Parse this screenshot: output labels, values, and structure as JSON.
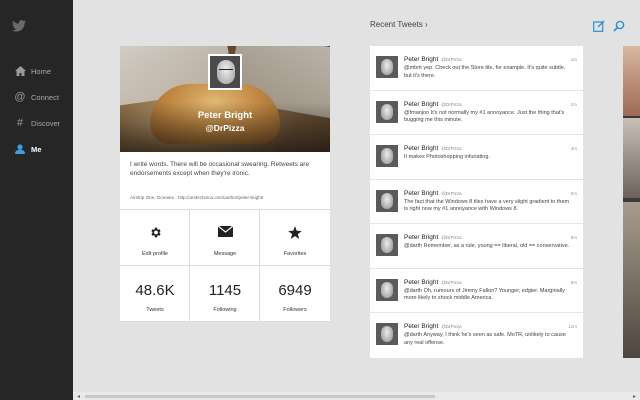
{
  "sidebar": {
    "logo_icon": "twitter-bird-icon",
    "items": [
      {
        "label": "Home",
        "icon": "home-icon",
        "active": false
      },
      {
        "label": "Connect",
        "icon": "at-icon",
        "active": false
      },
      {
        "label": "Discover",
        "icon": "hash-icon",
        "active": false
      },
      {
        "label": "Me",
        "icon": "person-icon",
        "active": true
      }
    ]
  },
  "profile": {
    "name": "Peter Bright",
    "handle": "@DrPizza",
    "bio": "I write words. There will be occasional swearing. Retweets are endorsements except when they're ironic.",
    "location_url": "Airstrip One, Oceania · http://arstechnica.com/author/peter-bright/",
    "actions": [
      {
        "label": "Edit profile",
        "icon": "gear-icon"
      },
      {
        "label": "Message",
        "icon": "envelope-icon"
      },
      {
        "label": "Favorites",
        "icon": "star-icon"
      }
    ],
    "stats": [
      {
        "value": "48.6K",
        "label": "Tweets"
      },
      {
        "value": "1145",
        "label": "Following"
      },
      {
        "value": "6949",
        "label": "Followers"
      }
    ]
  },
  "recent": {
    "header": "Recent Tweets ›",
    "icons": [
      "compose-icon",
      "search-icon"
    ],
    "tweets": [
      {
        "name": "Peter Bright",
        "handle": "@DrPizza",
        "time": "1m",
        "text": "@mbrit yep. Check out the Store tile, for example. It's quite subtle, but it's there."
      },
      {
        "name": "Peter Bright",
        "handle": "@DrPizza",
        "time": "2m",
        "text": "@fmanjoo It's not normally my #1 annoyance. Just the thing that's bugging me this minute."
      },
      {
        "name": "Peter Bright",
        "handle": "@DrPizza",
        "time": "4m",
        "text": "It makes Photoshopping infuriating."
      },
      {
        "name": "Peter Bright",
        "handle": "@DrPizza",
        "time": "5m",
        "text": "The fact that the Windows 8 tiles have a very slight gradient to them is right now my #1 annoyance with Windows 8."
      },
      {
        "name": "Peter Bright",
        "handle": "@DrPizza",
        "time": "8m",
        "text": "@darth Remember, as a rule, young == liberal, old == conservative."
      },
      {
        "name": "Peter Bright",
        "handle": "@DrPizza",
        "time": "9m",
        "text": "@darth Oh, rumours of Jimmy Fallon? Younger, edgier. Marginally more likely to shock middle America."
      },
      {
        "name": "Peter Bright",
        "handle": "@DrPizza",
        "time": "12m",
        "text": "@darth Anyway, I think he's seen as safe. MoTR, unlikely to cause any real offense."
      }
    ]
  },
  "scrollbar": {
    "left_arrow": "◂",
    "right_arrow": "▸"
  },
  "colors": {
    "sidebar_bg": "#262626",
    "accent": "#3aa0e0",
    "page_bg": "#e2e2e2"
  }
}
